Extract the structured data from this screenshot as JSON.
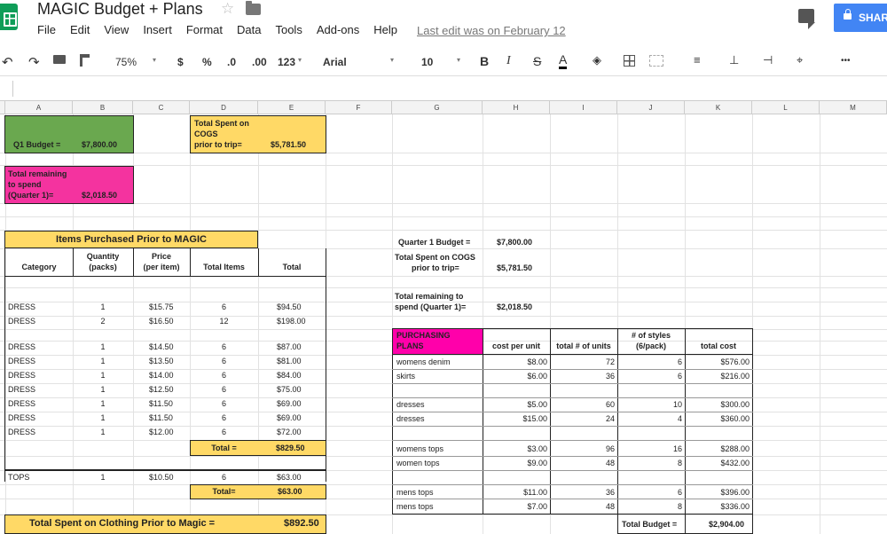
{
  "app": {
    "title": "MAGIC Budget + Plans",
    "menu": [
      "File",
      "Edit",
      "View",
      "Insert",
      "Format",
      "Data",
      "Tools",
      "Add-ons",
      "Help"
    ],
    "last_edit": "Last edit was on February 12",
    "share_label": "SHAR"
  },
  "toolbar": {
    "zoom": "75%",
    "currency": "$",
    "percent": "%",
    "dec_less": ".0",
    "dec_more": ".00",
    "number_format": "123",
    "font": "Arial",
    "font_size": "10",
    "bold": "B",
    "italic": "I",
    "strike": "S",
    "text_color": "A",
    "more": "•••"
  },
  "columns": [
    "A",
    "B",
    "C",
    "D",
    "E",
    "F",
    "G",
    "H",
    "I",
    "J",
    "K",
    "L",
    "M"
  ],
  "summary": {
    "q1_budget_label": "Q1 Budget =",
    "q1_budget_value": "$7,800.00",
    "cogs_label_1": "Total Spent on",
    "cogs_label_2": "COGS",
    "cogs_label_3": "prior to trip=",
    "cogs_value": "$5,781.50",
    "remaining_label_1": "Total remaining",
    "remaining_label_2": "to spend",
    "remaining_label_3": "(Quarter 1)=",
    "remaining_value": "$2,018.50"
  },
  "items_table": {
    "title": "Items Purchased Prior to MAGIC",
    "headers": {
      "category": "Category",
      "quantity_1": "Quantity",
      "quantity_2": "(packs)",
      "price_1": "Price",
      "price_2": "(per item)",
      "total_items": "Total Items",
      "total": "Total"
    },
    "rows": [
      {
        "category": "DRESS",
        "qty": "1",
        "price": "$15.75",
        "items": "6",
        "total": "$94.50"
      },
      {
        "category": "DRESS",
        "qty": "2",
        "price": "$16.50",
        "items": "12",
        "total": "$198.00"
      },
      {
        "category": "DRESS",
        "qty": "1",
        "price": "$14.50",
        "items": "6",
        "total": "$87.00"
      },
      {
        "category": "DRESS",
        "qty": "1",
        "price": "$13.50",
        "items": "6",
        "total": "$81.00"
      },
      {
        "category": "DRESS",
        "qty": "1",
        "price": "$14.00",
        "items": "6",
        "total": "$84.00"
      },
      {
        "category": "DRESS",
        "qty": "1",
        "price": "$12.50",
        "items": "6",
        "total": "$75.00"
      },
      {
        "category": "DRESS",
        "qty": "1",
        "price": "$11.50",
        "items": "6",
        "total": "$69.00"
      },
      {
        "category": "DRESS",
        "qty": "1",
        "price": "$11.50",
        "items": "6",
        "total": "$69.00"
      },
      {
        "category": "DRESS",
        "qty": "1",
        "price": "$12.00",
        "items": "6",
        "total": "$72.00"
      }
    ],
    "dress_total_label": "Total =",
    "dress_total_value": "$829.50",
    "tops_row": {
      "category": "TOPS",
      "qty": "1",
      "price": "$10.50",
      "items": "6",
      "total": "$63.00"
    },
    "tops_total_label": "Total=",
    "tops_total_value": "$63.00",
    "grand_label": "Total Spent on Clothing Prior to Magic =",
    "grand_value": "$892.50"
  },
  "right_summary": {
    "q1_label": "Quarter 1 Budget =",
    "q1_value": "$7,800.00",
    "cogs_label_1": "Total Spent on COGS",
    "cogs_label_2": "prior to trip=",
    "cogs_value": "$5,781.50",
    "remaining_label_1": "Total remaining to",
    "remaining_label_2": "spend (Quarter 1)=",
    "remaining_value": "$2,018.50"
  },
  "plans": {
    "title_1": "PURCHASING",
    "title_2": "PLANS",
    "headers": {
      "cost": "cost per unit",
      "units": "total # of units",
      "styles_1": "# of styles",
      "styles_2": "(6/pack)",
      "total_cost": "total cost"
    },
    "rows": [
      {
        "name": "womens denim",
        "cost": "$8.00",
        "units": "72",
        "styles": "6",
        "total": "$576.00"
      },
      {
        "name": "skirts",
        "cost": "$6.00",
        "units": "36",
        "styles": "6",
        "total": "$216.00"
      },
      {
        "name": "dresses",
        "cost": "$5.00",
        "units": "60",
        "styles": "10",
        "total": "$300.00"
      },
      {
        "name": "dresses",
        "cost": "$15.00",
        "units": "24",
        "styles": "4",
        "total": "$360.00"
      },
      {
        "name": "womens tops",
        "cost": "$3.00",
        "units": "96",
        "styles": "16",
        "total": "$288.00"
      },
      {
        "name": "women tops",
        "cost": "$9.00",
        "units": "48",
        "styles": "8",
        "total": "$432.00"
      },
      {
        "name": "mens tops",
        "cost": "$11.00",
        "units": "36",
        "styles": "6",
        "total": "$396.00"
      },
      {
        "name": "mens tops",
        "cost": "$7.00",
        "units": "48",
        "styles": "8",
        "total": "$336.00"
      }
    ],
    "budget_label": "Total Budget =",
    "budget_value": "$2,904.00"
  }
}
